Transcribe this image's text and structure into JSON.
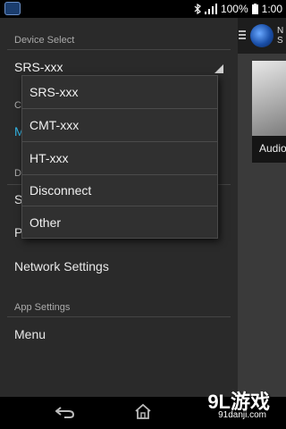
{
  "status_bar": {
    "battery": "100%",
    "time": "1:00"
  },
  "header": {
    "title_line1": "N",
    "title_line2": "S"
  },
  "content": {
    "tile_label": "Audio"
  },
  "drawer": {
    "device_select_header": "Device Select",
    "selected_device": "SRS-xxx",
    "partial_c": "C",
    "partial_m": "M",
    "partial_d": "D",
    "partial_s": "S",
    "partial_p": "P",
    "network_settings": "Network Settings",
    "app_settings_header": "App Settings",
    "menu": "Menu"
  },
  "dropdown": {
    "options": [
      "SRS-xxx",
      "CMT-xxx",
      "HT-xxx",
      "Disconnect",
      "Other"
    ]
  },
  "watermark": {
    "brand": "9L游戏",
    "site": "91danji.com"
  },
  "icons": {
    "bluetooth": "bluetooth-icon",
    "signal": "signal-icon",
    "battery": "battery-icon",
    "back": "back-icon",
    "home": "home-icon",
    "menu": "hamburger-icon"
  },
  "colors": {
    "drawer_bg": "#2a2a2a",
    "accent": "#33b5e5"
  }
}
